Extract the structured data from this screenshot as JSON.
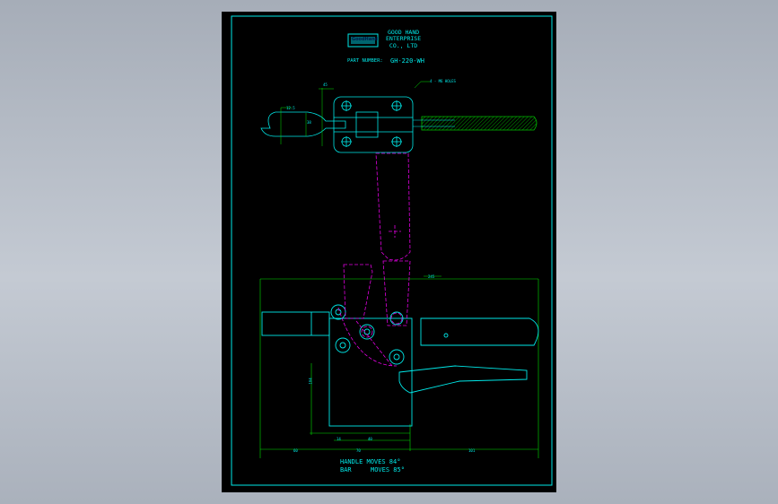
{
  "title_block": {
    "logo_text": "GoodHand",
    "company_line1": "GOOD HAND",
    "company_line2": "ENTERPRISE",
    "company_line3": "CO., LTD",
    "part_number_label": "PART NUMBER:",
    "part_number": "GH-220-WH"
  },
  "annotations": {
    "holes_callout": "4 - M6 HOLES",
    "handle_moves": "HANDLE MOVES 84°",
    "bar_label": "BAR",
    "bar_moves": "MOVES  85°"
  },
  "dimensions": {
    "top_width": "45",
    "arm_height": "12.5",
    "arm_offset": "38",
    "overall_length": "245",
    "left_reach": "60",
    "base_width": "70",
    "right_reach": "101",
    "bolt_pitch": "40",
    "bolt_edge": "14",
    "total_height": "104"
  },
  "colors": {
    "sheet_bg": "#000000",
    "outline": "#00e8e8",
    "dimension": "#00e000",
    "moving_part": "#e000e0",
    "handle_hatch": "#00c000"
  }
}
